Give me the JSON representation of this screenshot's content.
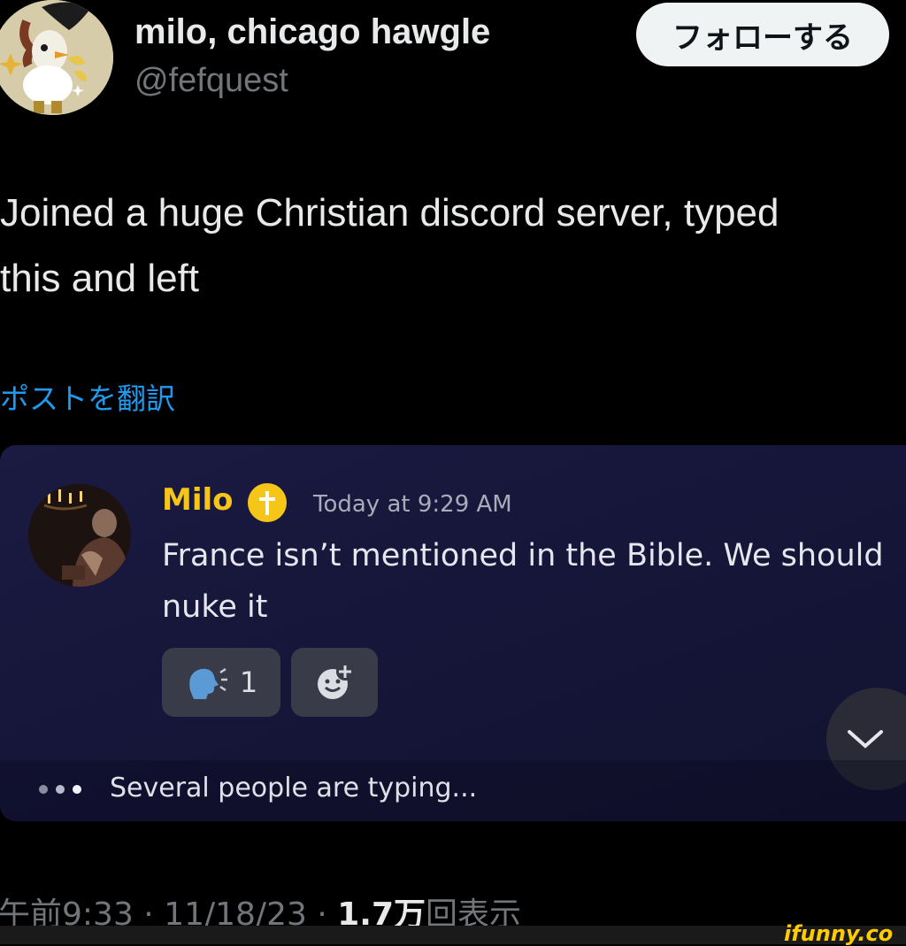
{
  "tweet": {
    "display_name": "milo, chicago hawgle",
    "handle": "@fefquest",
    "follow_label": "フォローする",
    "text_lines": [
      "Joined a huge Christian discord server, typed",
      "this and left"
    ],
    "translate_label": "ポストを翻訳",
    "footer": {
      "time": "午前9:33",
      "sep1": " · ",
      "date": "11/18/23",
      "sep2": " · ",
      "views": "1.7万",
      "views_suffix": "回表示"
    }
  },
  "discord": {
    "username": "Milo",
    "timestamp": "Today at 9:29 AM",
    "message_lines": [
      "France isn’t mentioned in the Bible. We should",
      "nuke it"
    ],
    "reaction_count": "1",
    "typing_text": "Several people are typing...",
    "colors": {
      "username": "#f5c518",
      "background": "#16163a"
    }
  },
  "icons": {
    "avatar": "cartoon-bird-avatar",
    "badge": "cross-badge-icon",
    "reaction": "speaking-head-emoji",
    "add_reaction": "add-reaction-icon",
    "scroll": "chevron-down-icon"
  },
  "watermark": "ifunny.co"
}
